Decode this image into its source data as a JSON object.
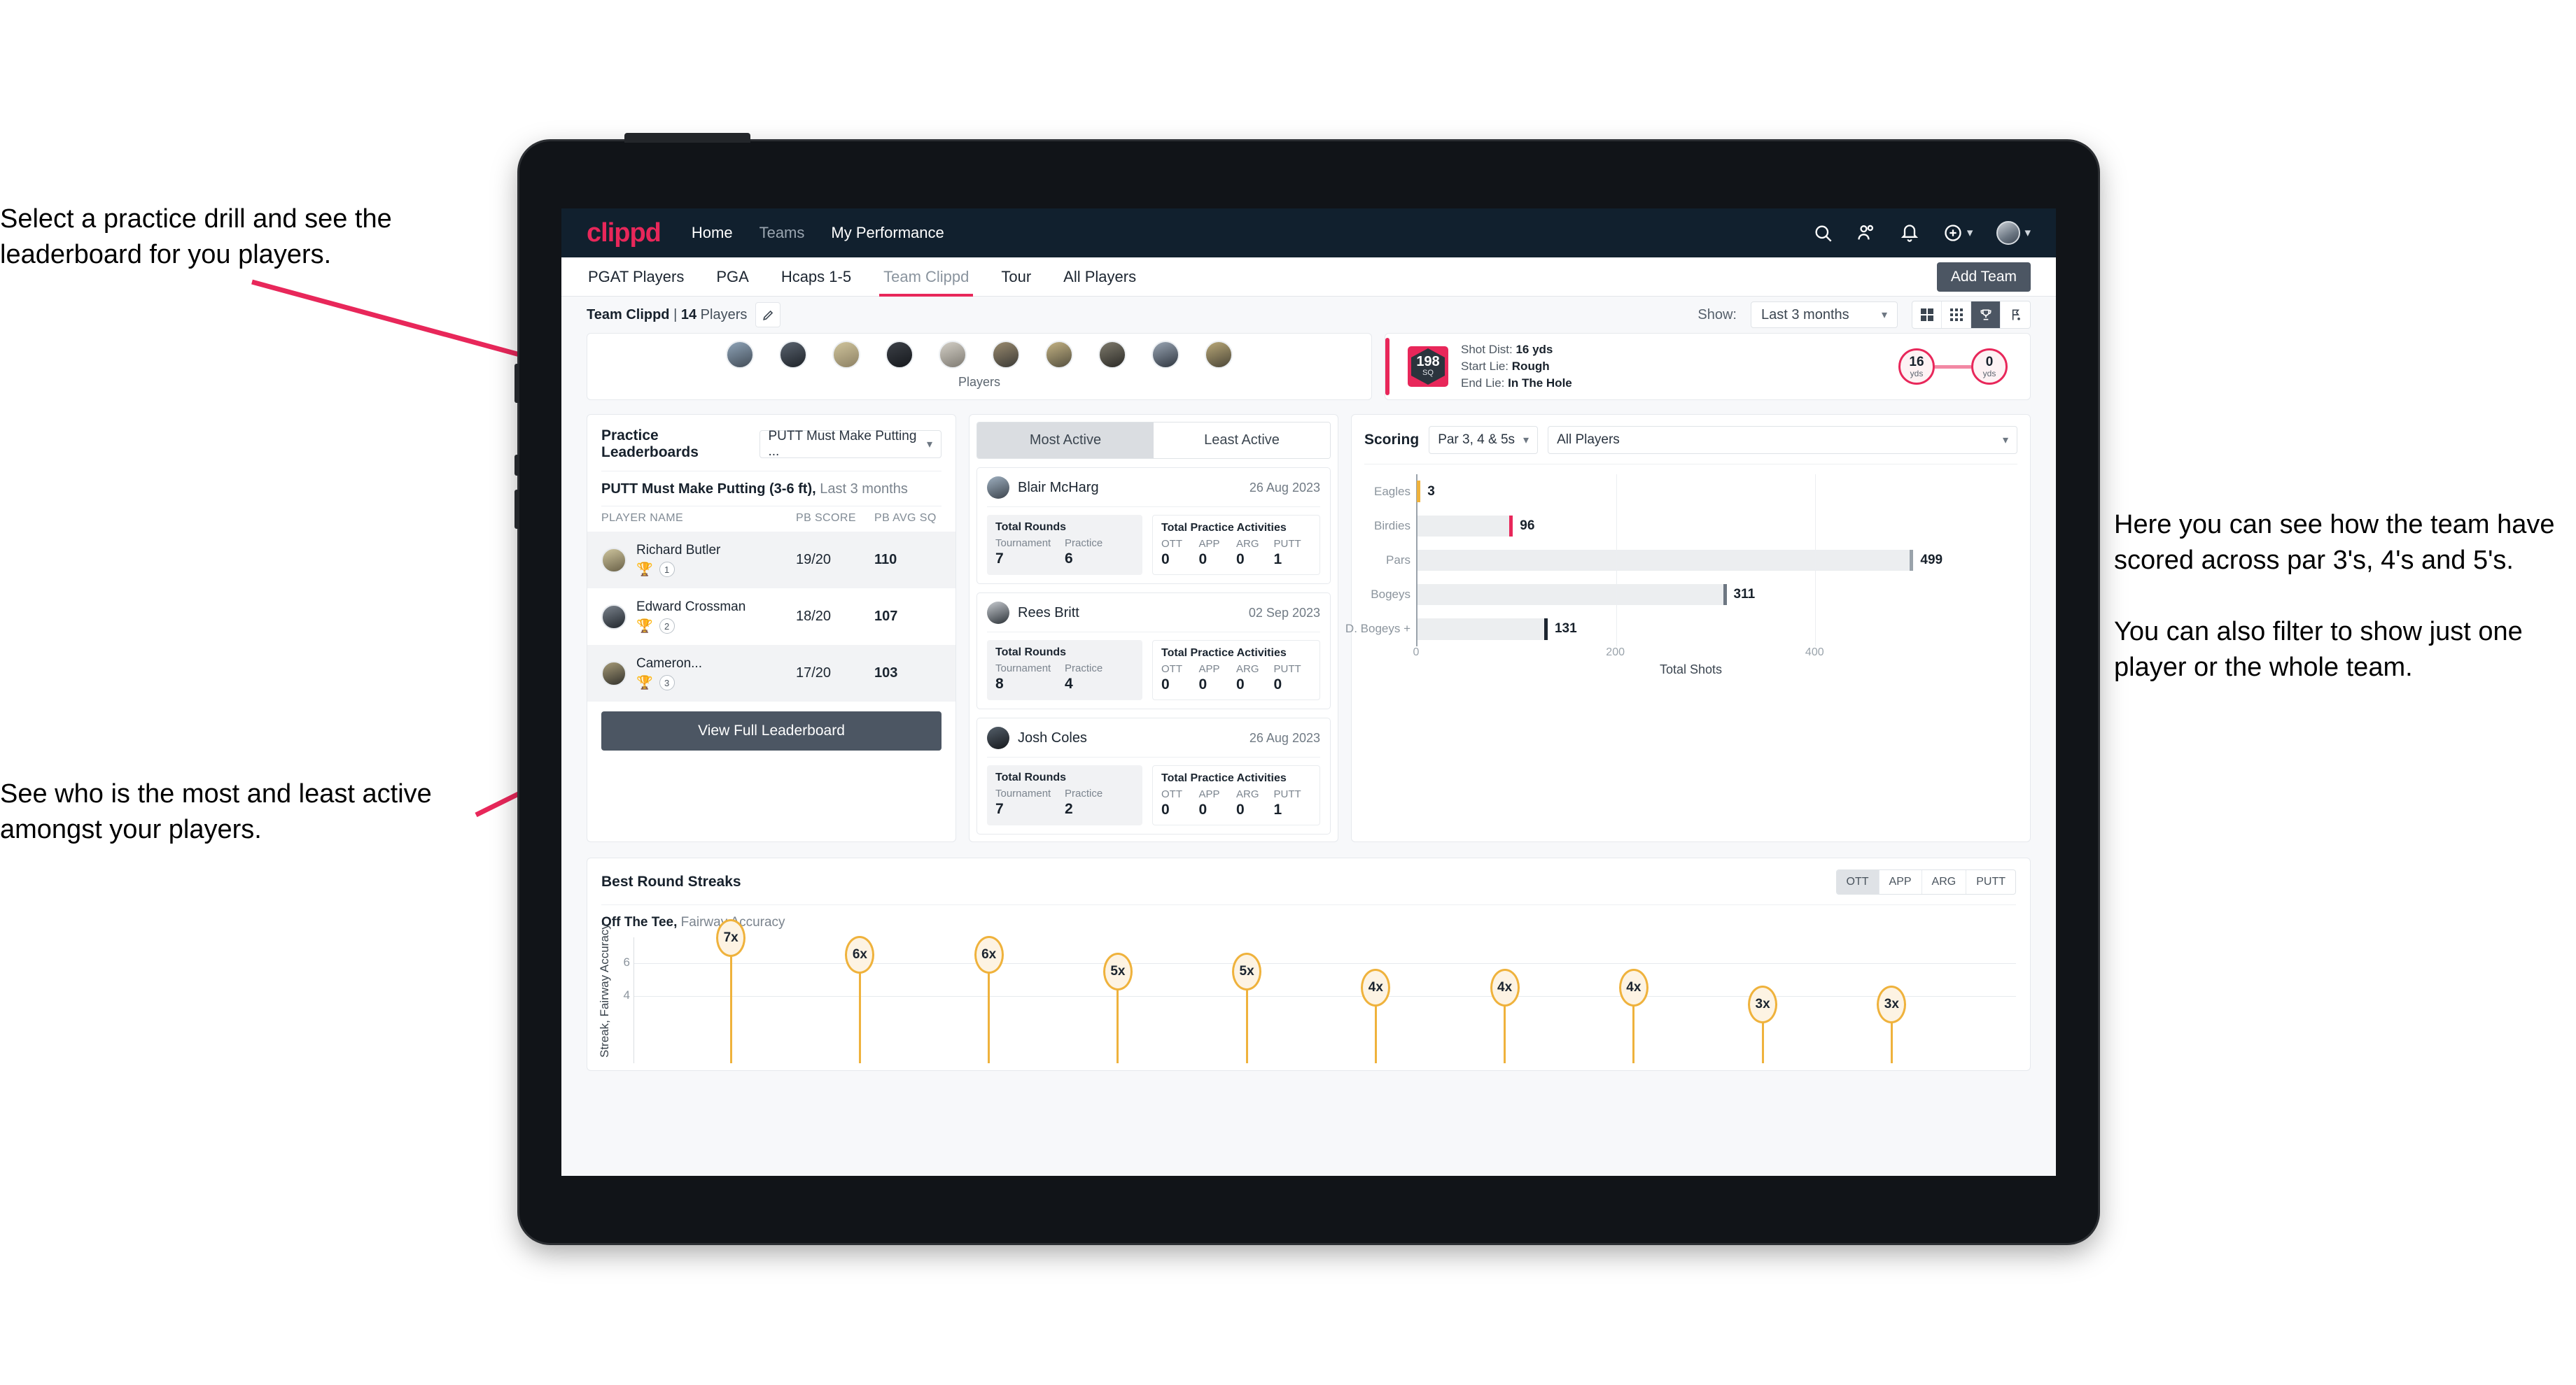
{
  "annotations": {
    "drill": "Select a practice drill and see the leaderboard for you players.",
    "active": "See who is the most and least active amongst your players.",
    "scoring": "Here you can see how the team have scored across par 3's, 4's and 5's.\n\nYou can also filter to show just one player or the whole team."
  },
  "app": {
    "logo": "clippd",
    "nav": [
      {
        "label": "Home",
        "dim": false
      },
      {
        "label": "Teams",
        "dim": true
      },
      {
        "label": "My Performance",
        "dim": false
      }
    ],
    "icons": [
      "search-icon",
      "people-icon",
      "bell-icon",
      "plus-circle-icon",
      "avatar"
    ],
    "tabs": [
      {
        "label": "PGAT Players",
        "active": false
      },
      {
        "label": "PGA",
        "active": false
      },
      {
        "label": "Hcaps 1-5",
        "active": false
      },
      {
        "label": "Team Clippd",
        "active": true
      },
      {
        "label": "Tour",
        "active": false
      },
      {
        "label": "All Players",
        "active": false
      }
    ],
    "add_team_label": "Add Team"
  },
  "subbar": {
    "team_name": "Team Clippd",
    "separator": "|",
    "player_count": "14",
    "players_word": "Players",
    "edit_icon": "pencil-icon",
    "show_label": "Show:",
    "period_value": "Last 3 months",
    "view_modes": [
      {
        "icon": "grid-large-icon",
        "active": false
      },
      {
        "icon": "grid-small-icon",
        "active": false
      },
      {
        "icon": "trophy-icon",
        "active": true
      },
      {
        "icon": "flag-icon",
        "active": false
      }
    ]
  },
  "players_card": {
    "label": "Players",
    "avatar_count": 10
  },
  "shot_card": {
    "badge_number": "198",
    "badge_unit": "SQ",
    "lines": [
      {
        "key": "Shot Dist:",
        "value": "16 yds"
      },
      {
        "key": "Start Lie:",
        "value": "Rough"
      },
      {
        "key": "End Lie:",
        "value": "In The Hole"
      }
    ],
    "start_dist": {
      "value": "16",
      "unit": "yds"
    },
    "end_dist": {
      "value": "0",
      "unit": "yds"
    }
  },
  "leaderboard": {
    "title": "Practice Leaderboards",
    "drill_select": "PUTT Must Make Putting ...",
    "subtitle_bold": "PUTT Must Make Putting (3-6 ft),",
    "subtitle_rest": " Last 3 months",
    "columns": [
      "PLAYER NAME",
      "PB SCORE",
      "PB AVG SQ"
    ],
    "rows": [
      {
        "name": "Richard Butler",
        "rank": "1",
        "medal": "gold",
        "pb_score": "19/20",
        "pb_avg_sq": "110"
      },
      {
        "name": "Edward Crossman",
        "rank": "2",
        "medal": "silver",
        "pb_score": "18/20",
        "pb_avg_sq": "107"
      },
      {
        "name": "Cameron...",
        "rank": "3",
        "medal": "bronze",
        "pb_score": "17/20",
        "pb_avg_sq": "103"
      }
    ],
    "button_label": "View Full Leaderboard"
  },
  "activity": {
    "tabs": [
      {
        "label": "Most Active",
        "active": true
      },
      {
        "label": "Least Active",
        "active": false
      }
    ],
    "rounds_title": "Total Rounds",
    "practice_title": "Total Practice Activities",
    "rounds_keys": [
      "Tournament",
      "Practice"
    ],
    "practice_keys": [
      "OTT",
      "APP",
      "ARG",
      "PUTT"
    ],
    "entries": [
      {
        "name": "Blair McHarg",
        "date": "26 Aug 2023",
        "tournament": "7",
        "practice": "6",
        "ott": "0",
        "app": "0",
        "arg": "0",
        "putt": "1"
      },
      {
        "name": "Rees Britt",
        "date": "02 Sep 2023",
        "tournament": "8",
        "practice": "4",
        "ott": "0",
        "app": "0",
        "arg": "0",
        "putt": "0"
      },
      {
        "name": "Josh Coles",
        "date": "26 Aug 2023",
        "tournament": "7",
        "practice": "2",
        "ott": "0",
        "app": "0",
        "arg": "0",
        "putt": "1"
      }
    ]
  },
  "scoring": {
    "title": "Scoring",
    "par_filter": "Par 3, 4 & 5s",
    "player_filter": "All Players"
  },
  "streaks": {
    "title": "Best Round Streaks",
    "toggle": [
      {
        "label": "OTT",
        "active": true
      },
      {
        "label": "APP",
        "active": false
      },
      {
        "label": "ARG",
        "active": false
      },
      {
        "label": "PUTT",
        "active": false
      }
    ],
    "sub_bold": "Off The Tee,",
    "sub_rest": " Fairway Accuracy"
  },
  "chart_data": [
    {
      "type": "bar",
      "orientation": "horizontal",
      "title": "Scoring",
      "categories": [
        "Eagles",
        "Birdies",
        "Pars",
        "Bogeys",
        "D. Bogeys +"
      ],
      "values": [
        3,
        96,
        499,
        311,
        131
      ],
      "cap_colors": [
        "#efb23c",
        "#e8275a",
        "#9aa3ab",
        "#6d7782",
        "#1c2530"
      ],
      "xlabel": "Total Shots",
      "ylabel": "",
      "xticks": [
        0,
        200,
        400
      ],
      "xlim": [
        0,
        560
      ],
      "grid": true,
      "legend": "none"
    },
    {
      "type": "lollipop",
      "title": "Best Round Streaks",
      "subtitle": "Off The Tee, Fairway Accuracy",
      "ylabel": "Streak, Fairway Accuracy",
      "yticks": [
        4,
        6
      ],
      "ylim": [
        0,
        7.6
      ],
      "values": [
        7,
        6,
        6,
        5,
        5,
        4,
        4,
        4,
        3,
        3
      ],
      "labels": [
        "7x",
        "6x",
        "6x",
        "5x",
        "5x",
        "4x",
        "4x",
        "4x",
        "3x",
        "3x"
      ],
      "grid": true,
      "marker_color": "#efb23c"
    }
  ]
}
